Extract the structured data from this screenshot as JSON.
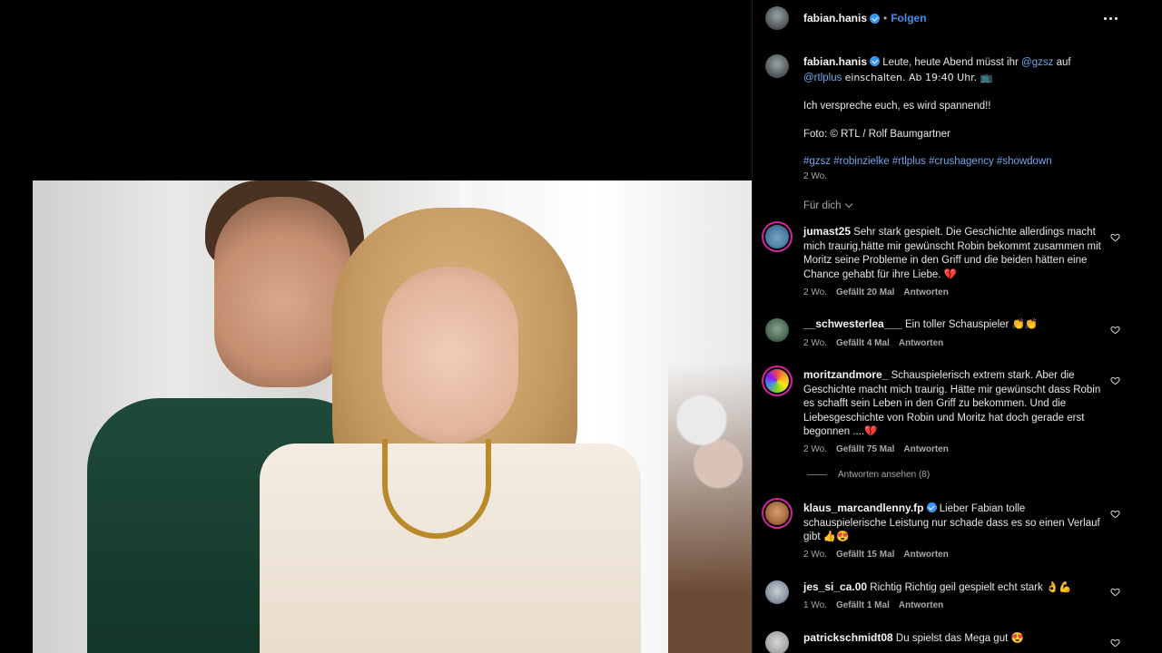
{
  "post": {
    "owner": "fabian.hanis",
    "follow_label": "Folgen",
    "separator": "•",
    "caption": {
      "username": "fabian.hanis",
      "line1_text": "Leute, heute Abend müsst ihr",
      "mention1": "@gzsz",
      "line1_suffix": "auf",
      "mention2": "@rtlplus",
      "line2_text": "einschalten. Ab 19:40 Uhr. 📺",
      "paragraph2": "Ich verspreche euch, es wird spannend!!",
      "paragraph3": "Foto: © RTL / Rolf Baumgartner",
      "hashtags": [
        "#gzsz",
        "#robinzielke",
        "#rtlplus",
        "#crushagency",
        "#showdown"
      ],
      "age": "2 Wo."
    },
    "sort_label": "Für dich"
  },
  "comments": [
    {
      "username": "jumast25",
      "text": "Sehr stark gespielt. Die Geschichte allerdings macht mich traurig,hätte mir gewünscht Robin bekommt zusammen mit Moritz seine Probleme in den Griff und die beiden hätten eine Chance gehabt für ihre Liebe. 💔",
      "age": "2 Wo.",
      "likes": "Gefällt 20 Mal",
      "reply": "Antworten"
    },
    {
      "username": "__schwesterlea___",
      "text": "Ein toller Schauspieler 👏👏",
      "age": "2 Wo.",
      "likes": "Gefällt 4 Mal",
      "reply": "Antworten"
    },
    {
      "username": "moritzandmore_",
      "text": "Schauspielerisch extrem stark. Aber die Geschichte macht mich traurig. Hätte mir gewünscht dass Robin es schafft sein Leben in den Griff zu bekommen. Und die Liebesgeschichte von Robin und Moritz hat doch gerade erst begonnen ....💔",
      "age": "2 Wo.",
      "likes": "Gefällt 75 Mal",
      "reply": "Antworten",
      "view_replies": "Antworten ansehen (8)"
    },
    {
      "username": "klaus_marcandlenny.fp",
      "text": "Lieber Fabian tolle schauspielerische Leistung nur schade dass es so einen Verlauf gibt 👍😍",
      "age": "2 Wo.",
      "likes": "Gefällt 15 Mal",
      "reply": "Antworten"
    },
    {
      "username": "jes_si_ca.00",
      "text": "Richtig Richtig geil gespielt echt stark 👌💪",
      "age": "1 Wo.",
      "likes": "Gefällt 1 Mal",
      "reply": "Antworten"
    },
    {
      "username": "patrickschmidt08",
      "text": "Du spielst das Mega gut 😍"
    }
  ],
  "colors": {
    "link": "#6fa8ef",
    "follow": "#4192ef",
    "verified": "#3897f0",
    "muted": "#a8a8a8"
  },
  "icons": [
    "more-icon",
    "verified-icon",
    "heart-icon",
    "chevron-down-icon"
  ]
}
